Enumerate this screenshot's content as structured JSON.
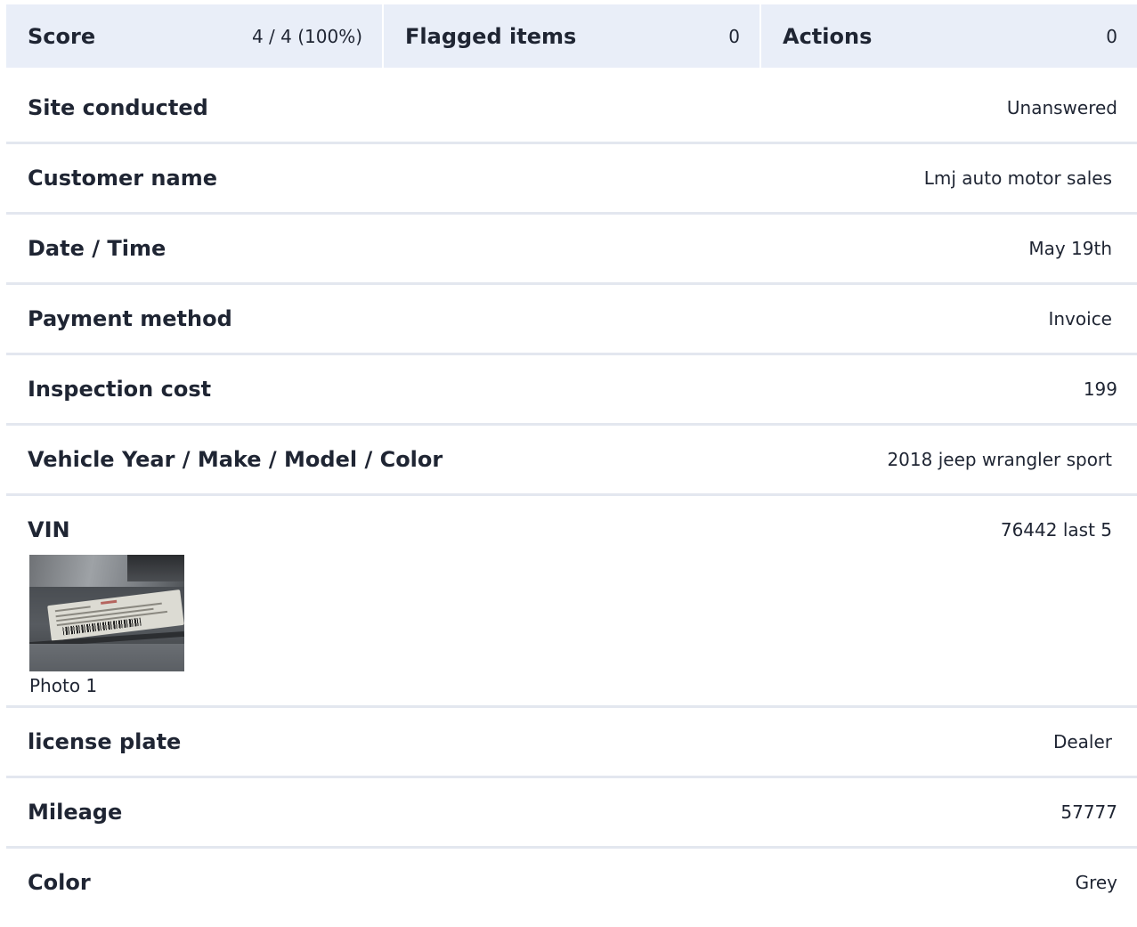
{
  "summary": {
    "score_label": "Score",
    "score_value": "4 / 4 (100%)",
    "flagged_label": "Flagged items",
    "flagged_value": "0",
    "actions_label": "Actions",
    "actions_value": "0"
  },
  "fields": {
    "site": {
      "label": "Site conducted",
      "value": "Unanswered"
    },
    "customer": {
      "label": "Customer name",
      "value": "Lmj auto motor sales"
    },
    "datetime": {
      "label": "Date / Time",
      "value": "May 19th"
    },
    "payment": {
      "label": "Payment method",
      "value": "Invoice"
    },
    "cost": {
      "label": "Inspection cost",
      "value": "199"
    },
    "vehicle": {
      "label": "Vehicle Year / Make / Model / Color",
      "value": "2018 jeep wrangler sport"
    },
    "vin": {
      "label": "VIN",
      "value": "76442 last 5",
      "photo_caption": "Photo 1"
    },
    "plate": {
      "label": "license plate",
      "value": "Dealer"
    },
    "mileage": {
      "label": "Mileage",
      "value": "57777"
    },
    "color": {
      "label": "Color",
      "value": "Grey"
    }
  }
}
